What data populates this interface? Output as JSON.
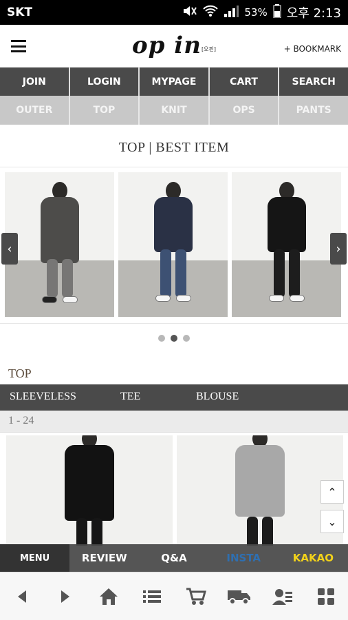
{
  "status_bar": {
    "carrier": "SKT",
    "battery": "53%",
    "time": "오후 2:13"
  },
  "header": {
    "logo": "op in",
    "logo_sub": "[오핀]",
    "bookmark": "+ BOOKMARK"
  },
  "nav_primary": [
    "JOIN",
    "LOGIN",
    "MYPAGE",
    "CART",
    "SEARCH"
  ],
  "nav_secondary": [
    "OUTER",
    "TOP",
    "KNIT",
    "OPS",
    "PANTS"
  ],
  "best_section": {
    "title": "TOP | BEST ITEM",
    "prev_icon": "‹",
    "next_icon": "›",
    "slide_count": 3,
    "active_slide": 2
  },
  "top_section": {
    "label": "TOP",
    "subcategories": [
      "SLEEVELESS",
      "TEE",
      "BLOUSE"
    ],
    "range": "1 - 24"
  },
  "scroll": {
    "up_icon": "⌃",
    "down_icon": "⌄"
  },
  "bottom_menu": [
    "MENU",
    "REVIEW",
    "Q&A",
    "INSTA",
    "KAKAO"
  ],
  "colors": {
    "insta": "#2f6fb0",
    "kakao": "#f2d21a",
    "dark_bar": "#4a4a4a"
  },
  "browser_icons": [
    "back-icon",
    "forward-icon",
    "home-icon",
    "list-icon",
    "cart-icon",
    "delivery-icon",
    "account-icon",
    "grid-icon"
  ]
}
